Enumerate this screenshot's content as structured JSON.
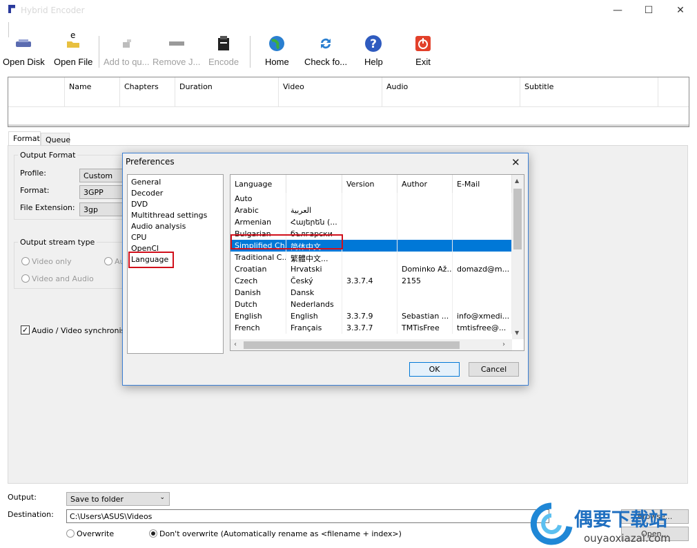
{
  "window": {
    "title": "Hybrid Encoder"
  },
  "toolbar": {
    "open_disk": "Open Disk",
    "open_file": "Open File",
    "add_to_queue": "Add to qu...",
    "remove_job": "Remove J...",
    "encode": "Encode",
    "home": "Home",
    "check_updates": "Check fo...",
    "help": "Help",
    "exit": "Exit",
    "floating_text": "e"
  },
  "source_table": {
    "columns": [
      "",
      "Name",
      "Chapters",
      "Duration",
      "Video",
      "Audio",
      "Subtitle"
    ]
  },
  "tabs": {
    "format": "Format",
    "queue": "Queue"
  },
  "output_format": {
    "title": "Output Format",
    "profile_label": "Profile:",
    "profile_value": "Custom",
    "format_label": "Format:",
    "format_value": "3GPP",
    "ext_label": "File Extension:",
    "ext_value": "3gp"
  },
  "stream_type": {
    "title": "Output stream type",
    "video_only": "Video only",
    "audio_partial": "Au",
    "video_and_audio": "Video and Audio"
  },
  "av_sync": "Audio / Video synchronisati",
  "dialog": {
    "title": "Preferences",
    "categories": [
      "General",
      "Decoder",
      "DVD",
      "Multithread settings",
      "Audio analysis",
      "CPU",
      "OpenCl",
      "Language"
    ],
    "columns": [
      "Language",
      "",
      "Version",
      "Author",
      "E-Mail"
    ],
    "rows": [
      {
        "lang": "Auto",
        "native": "",
        "version": "",
        "author": "",
        "email": ""
      },
      {
        "lang": "Arabic",
        "native": "العربية",
        "version": "",
        "author": "",
        "email": ""
      },
      {
        "lang": "Armenian",
        "native": "Հայերեն (...",
        "version": "",
        "author": "",
        "email": ""
      },
      {
        "lang": "Bulgarian",
        "native": "български",
        "version": "",
        "author": "",
        "email": ""
      },
      {
        "lang": "Simplified Ch...",
        "native": "简体中文...",
        "version": "",
        "author": "",
        "email": ""
      },
      {
        "lang": "Traditional C...",
        "native": "繁體中文...",
        "version": "",
        "author": "",
        "email": ""
      },
      {
        "lang": "Croatian",
        "native": "Hrvatski",
        "version": "",
        "author": "Dominko Až...",
        "email": "domazd@m..."
      },
      {
        "lang": "Czech",
        "native": "Český",
        "version": "3.3.7.4",
        "author": "2155",
        "email": ""
      },
      {
        "lang": "Danish",
        "native": "Dansk",
        "version": "",
        "author": "",
        "email": ""
      },
      {
        "lang": "Dutch",
        "native": "Nederlands",
        "version": "",
        "author": "",
        "email": ""
      },
      {
        "lang": "English",
        "native": "English",
        "version": "3.3.7.9",
        "author": "Sebastian ...",
        "email": "info@xmedi..."
      },
      {
        "lang": "French",
        "native": "Français",
        "version": "3.3.7.7",
        "author": "TMTisFree",
        "email": "tmtisfree@..."
      }
    ],
    "ok": "OK",
    "cancel": "Cancel"
  },
  "output": {
    "label": "Output:",
    "value": "Save to folder",
    "dest_label": "Destination:",
    "dest_value": "C:\\Users\\ASUS\\Videos",
    "browse": "Browse...",
    "open": "Open...",
    "overwrite": "Overwrite",
    "dont_overwrite": "Don't overwrite (Automatically rename as <filename + index>)"
  },
  "watermark": {
    "brand": "偶要下载站",
    "url": "ouyaoxiazai.com"
  }
}
